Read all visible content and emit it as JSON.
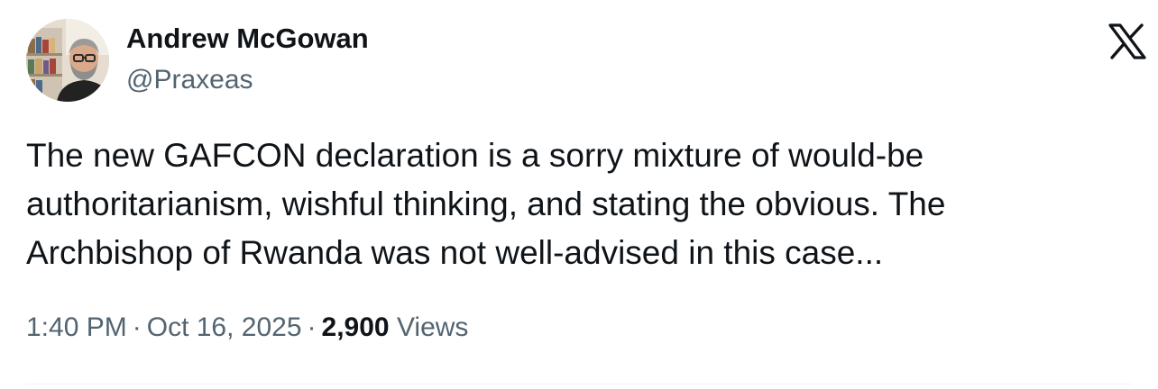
{
  "author": {
    "name": "Andrew McGowan",
    "handle": "@Praxeas",
    "avatar_icon": "profile-photo"
  },
  "brand": {
    "icon": "x-logo-icon"
  },
  "tweet": {
    "lines": [
      "The new GAFCON declaration is a sorry mixture of would-be",
      "authoritarianism, wishful thinking, and stating the obvious. The",
      "Archbishop of Rwanda was not well-advised in this case..."
    ]
  },
  "meta": {
    "time": "1:40 PM",
    "separator": "·",
    "date": "Oct 16, 2025",
    "views_count": "2,900",
    "views_label": "Views"
  },
  "colors": {
    "text_primary": "#0f1419",
    "text_secondary": "#536471",
    "divider": "#eff3f4"
  }
}
